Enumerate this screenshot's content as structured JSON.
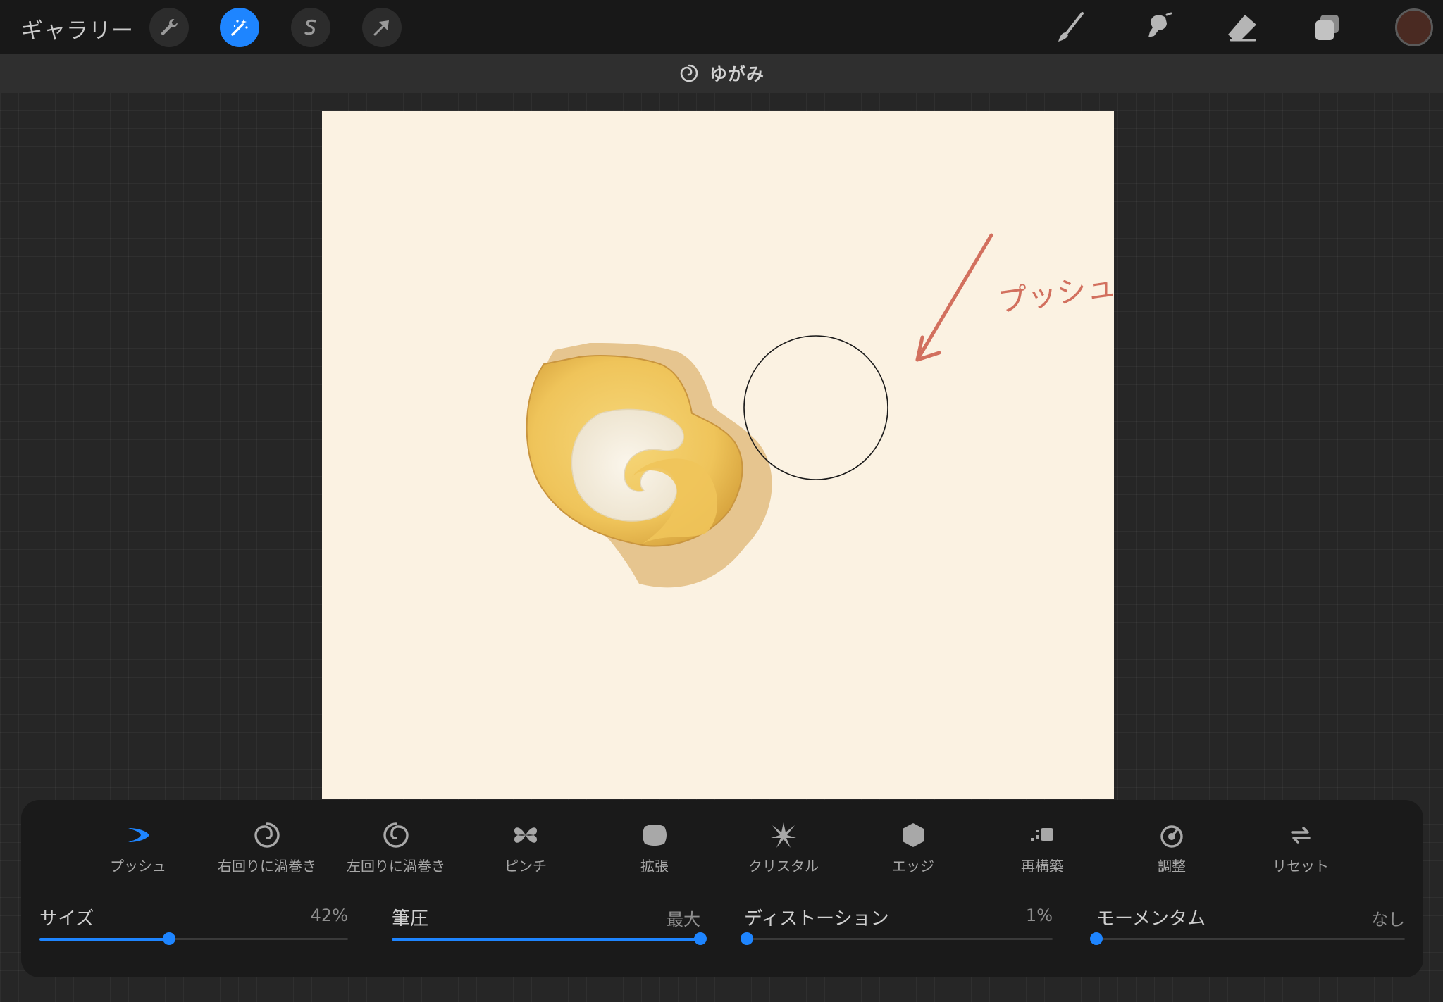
{
  "topbar": {
    "gallery_label": "ギャラリー",
    "left_tools": [
      {
        "icon": "wrench-icon",
        "name": "actions"
      },
      {
        "icon": "magic-wand-icon",
        "name": "adjustments",
        "active": true
      },
      {
        "icon": "selection-s-icon",
        "name": "selection"
      },
      {
        "icon": "transform-arrow-icon",
        "name": "transform"
      }
    ],
    "right_tools": [
      {
        "icon": "brush-icon",
        "name": "paint"
      },
      {
        "icon": "smudge-icon",
        "name": "smudge"
      },
      {
        "icon": "eraser-icon",
        "name": "eraser"
      },
      {
        "icon": "layers-icon",
        "name": "layers"
      }
    ],
    "color_swatch": "#4a2a22"
  },
  "mode_header": {
    "icon": "swirl-icon",
    "title": "ゆがみ"
  },
  "canvas": {
    "annotation": "プッシュ",
    "annotation_color": "#d2705e"
  },
  "liquify_modes": [
    {
      "label": "プッシュ",
      "icon": "push-icon",
      "selected": true
    },
    {
      "label": "右回りに渦巻き",
      "icon": "twirl-right-icon"
    },
    {
      "label": "左回りに渦巻き",
      "icon": "twirl-left-icon"
    },
    {
      "label": "ピンチ",
      "icon": "pinch-icon"
    },
    {
      "label": "拡張",
      "icon": "expand-icon"
    },
    {
      "label": "クリスタル",
      "icon": "crystals-icon"
    },
    {
      "label": "エッジ",
      "icon": "edge-icon"
    },
    {
      "label": "再構築",
      "icon": "reconstruct-icon"
    },
    {
      "label": "調整",
      "icon": "adjust-icon"
    },
    {
      "label": "リセット",
      "icon": "reset-icon"
    }
  ],
  "sliders": [
    {
      "label": "サイズ",
      "value": "42%",
      "fraction": 0.42
    },
    {
      "label": "筆圧",
      "value": "最大",
      "fraction": 1.0
    },
    {
      "label": "ディストーション",
      "value": "1%",
      "fraction": 0.01
    },
    {
      "label": "モーメンタム",
      "value": "なし",
      "fraction": 0.0
    }
  ],
  "colors": {
    "accent": "#1e85ff",
    "toolbar": "#181818",
    "panel": "#1a1a1a",
    "paper": "#fbf2e2"
  }
}
